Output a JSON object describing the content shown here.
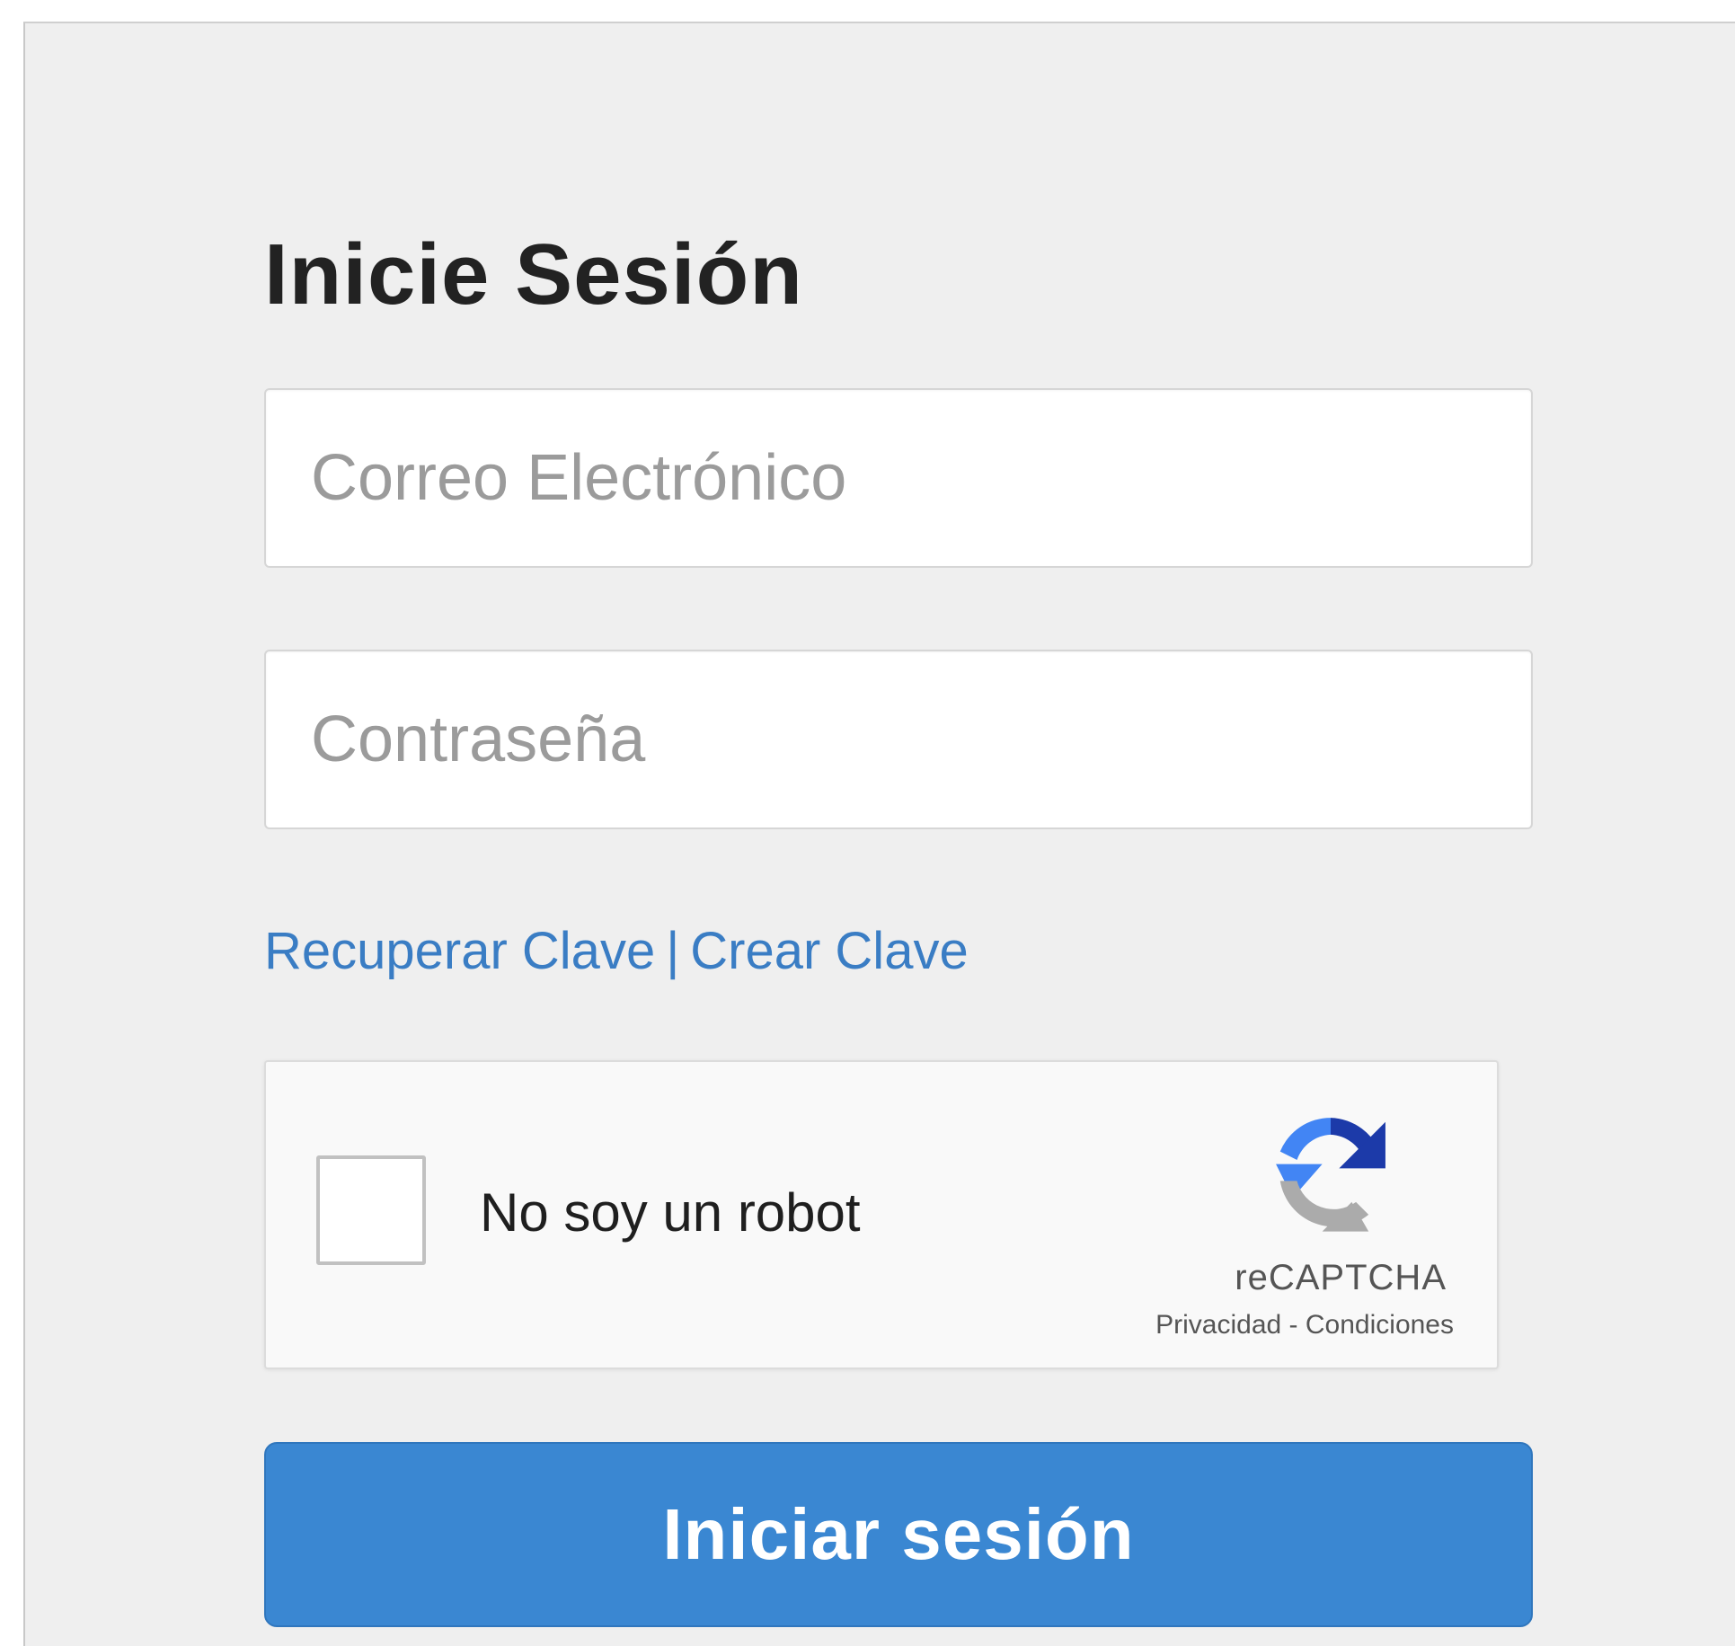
{
  "login": {
    "title": "Inicie Sesión",
    "email_placeholder": "Correo Electrónico",
    "password_placeholder": "Contraseña",
    "links": {
      "recover": "Recuperar Clave",
      "separator": "|",
      "create": "Crear Clave"
    },
    "captcha": {
      "label": "No soy un robot",
      "brand": "reCAPTCHA",
      "privacy": "Privacidad",
      "dash": "-",
      "terms": "Condiciones",
      "checked": false,
      "logo_icon": "recaptcha-logo-icon"
    },
    "submit_label": "Iniciar sesión"
  },
  "colors": {
    "link": "#3a7dc4",
    "button": "#3a87d2",
    "background": "#efefef"
  }
}
